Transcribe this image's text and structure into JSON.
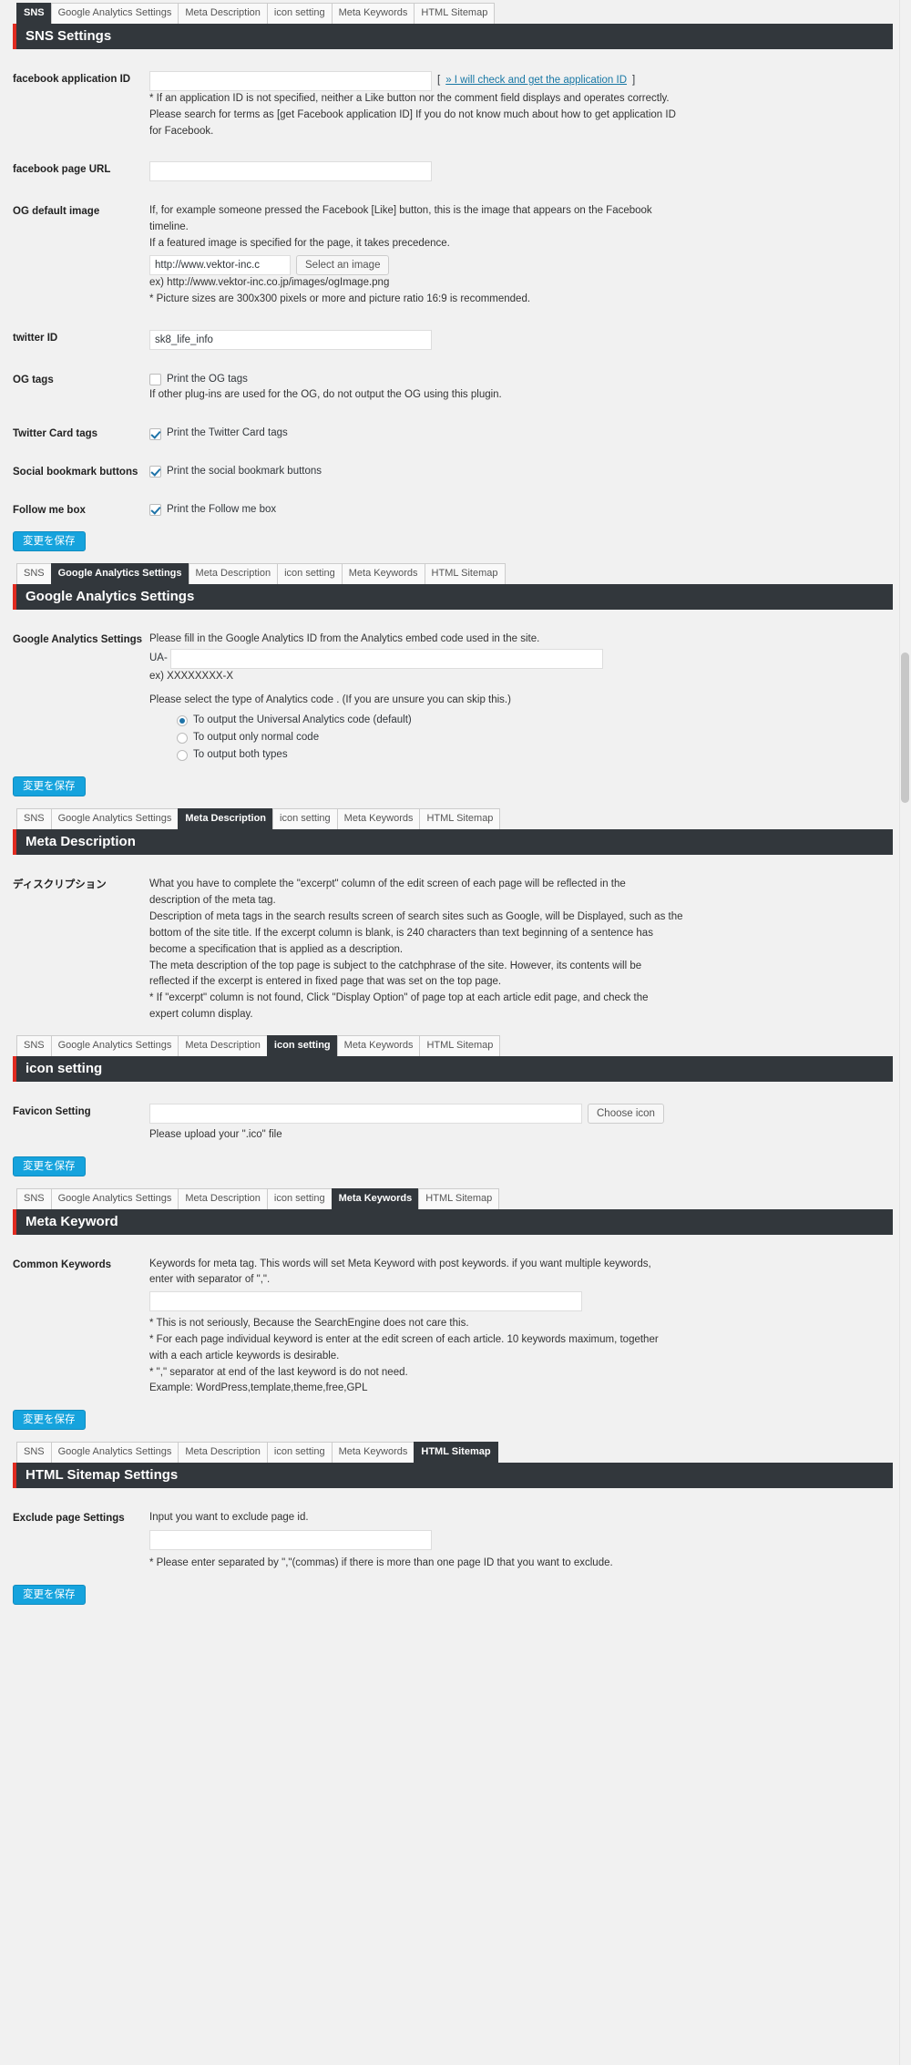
{
  "tabs": [
    {
      "id": "sns",
      "label": "SNS"
    },
    {
      "id": "ga",
      "label": "Google Analytics Settings"
    },
    {
      "id": "meta_desc",
      "label": "Meta Description"
    },
    {
      "id": "icon",
      "label": "icon setting"
    },
    {
      "id": "meta_kw",
      "label": "Meta Keywords"
    },
    {
      "id": "sitemap",
      "label": "HTML Sitemap"
    }
  ],
  "save_label": "変更を保存",
  "sns": {
    "heading": "SNS Settings",
    "fb_app_id": {
      "label": "facebook application ID",
      "value": "",
      "bracket_open": "[",
      "link": "» I will check and get the application ID",
      "bracket_close": "]",
      "note_line1": "* If an application ID is not specified, neither a Like button nor the comment field displays and operates correctly.",
      "note_line2": "Please search for terms as [get Facebook application ID] If you do not know much about how to get application ID",
      "note_line3": "for Facebook."
    },
    "fb_page_url": {
      "label": "facebook page URL",
      "value": ""
    },
    "og_default_image": {
      "label": "OG default image",
      "desc_line1": "If, for example someone pressed the Facebook [Like] button, this is the image that appears on the Facebook",
      "desc_line2": "timeline.",
      "desc_line3": "If a featured image is specified for the page, it takes precedence.",
      "value": "http://www.vektor-inc.c",
      "select_button": "Select an image",
      "example": "ex) http://www.vektor-inc.co.jp/images/ogImage.png",
      "note": "* Picture sizes are 300x300 pixels or more and picture ratio 16:9 is recommended."
    },
    "twitter_id": {
      "label": "twitter ID",
      "value": "sk8_life_info"
    },
    "og_tags": {
      "label": "OG tags",
      "checkbox_label": "Print the OG tags",
      "checked": false,
      "note": "If other plug-ins are used for the OG, do not output the OG using this plugin."
    },
    "twitter_card": {
      "label": "Twitter Card tags",
      "checkbox_label": "Print the Twitter Card tags",
      "checked": true
    },
    "social_bookmark": {
      "label": "Social bookmark buttons",
      "checkbox_label": "Print the social bookmark buttons",
      "checked": true
    },
    "follow_me": {
      "label": "Follow me box",
      "checkbox_label": "Print the Follow me box",
      "checked": true
    }
  },
  "ga": {
    "heading": "Google Analytics Settings",
    "label": "Google Analytics Settings",
    "desc": "Please fill in the Google Analytics ID from the Analytics embed code used in the site.",
    "prefix": "UA-",
    "value": "",
    "example": "ex) XXXXXXXX-X",
    "type_desc": "Please select the type of Analytics code . (If you are unsure you can skip this.)",
    "options": [
      {
        "label": "To output the Universal Analytics code (default)",
        "checked": true
      },
      {
        "label": "To output only normal code",
        "checked": false
      },
      {
        "label": "To output both types",
        "checked": false
      }
    ]
  },
  "meta_description": {
    "heading": "Meta Description",
    "label": "ディスクリプション",
    "lines": [
      "What you have to complete the \"excerpt\" column of the edit screen of each page will be reflected in the",
      "description of the meta tag.",
      "Description of meta tags in the search results screen of search sites such as Google, will be Displayed, such as the",
      "bottom of the site title. If the excerpt column is blank, is 240 characters than text beginning of a sentence has",
      "become a specification that is applied as a description.",
      "The meta description of the top page is subject to the catchphrase of the site. However, its contents will be",
      "reflected if the excerpt is entered in fixed page that was set on the top page.",
      "* If \"excerpt\" column is not found, Click \"Display Option\" of page top at each article edit page, and check the",
      "expert column display."
    ]
  },
  "icon_setting": {
    "heading": "icon setting",
    "label": "Favicon Setting",
    "value": "",
    "choose_button": "Choose icon",
    "note": "Please upload your \".ico\" file"
  },
  "meta_keyword": {
    "heading": "Meta Keyword",
    "label": "Common Keywords",
    "desc_line1": "Keywords for meta tag. This words will set Meta Keyword with post keywords. if you want multiple keywords,",
    "desc_line2": "enter with separator of \",\".",
    "value": "",
    "notes": [
      "* This is not seriously, Because the SearchEngine does not care this.",
      "* For each page individual keyword is enter at the edit screen of each article. 10 keywords maximum, together",
      "with a each article keywords is desirable.",
      "* \",\" separator at end of the last keyword is do not need.",
      "Example: WordPress,template,theme,free,GPL"
    ]
  },
  "sitemap": {
    "heading": "HTML Sitemap Settings",
    "label": "Exclude page Settings",
    "desc": "Input you want to exclude page id.",
    "value": "",
    "note": "* Please enter separated by \",\"(commas) if there is more than one page ID that you want to exclude."
  }
}
